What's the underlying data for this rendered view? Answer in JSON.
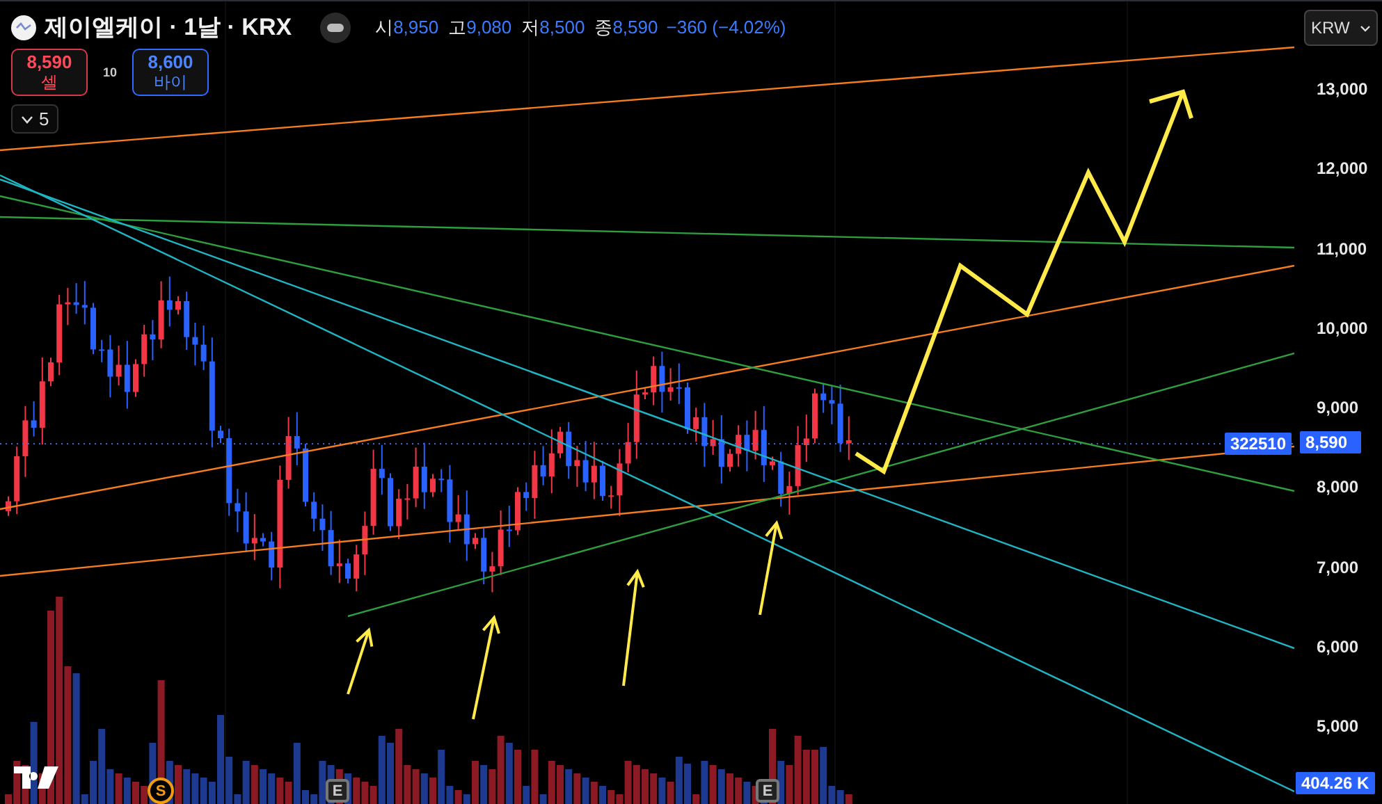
{
  "header": {
    "title": "제이엘케이 · 1날 · KRX",
    "ohlc": [
      {
        "label": "시",
        "value": "8,950"
      },
      {
        "label": "고",
        "value": "9,080"
      },
      {
        "label": "저",
        "value": "8,500"
      },
      {
        "label": "종",
        "value": "8,590"
      }
    ],
    "change": "−360 (−4.02%)"
  },
  "trade": {
    "sell": {
      "price": "8,590",
      "label": "셀"
    },
    "spread": "10",
    "buy": {
      "price": "8,600",
      "label": "바이"
    }
  },
  "interval_toggle": {
    "label": "5"
  },
  "currency": {
    "label": "KRW"
  },
  "price_axis": {
    "labels": [
      "13,000",
      "12,000",
      "11,000",
      "10,000",
      "9,000",
      "8,000",
      "7,000",
      "6,000",
      "5,000"
    ]
  },
  "last_price": {
    "volume_label": "322510",
    "price": "8,590"
  },
  "volume_tag": "404.26 K",
  "event_markers": [
    {
      "kind": "split",
      "text": "S"
    },
    {
      "kind": "earnings",
      "text": "E"
    },
    {
      "kind": "earnings",
      "text": "E"
    }
  ]
}
